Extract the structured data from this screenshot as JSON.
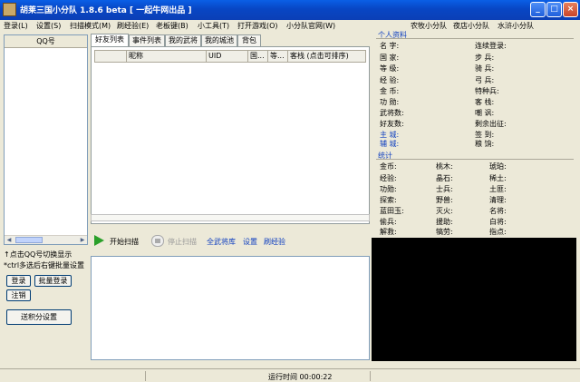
{
  "window": {
    "title": "胡莱三国小分队 1.8.6 beta [ 一起牛网出品 ]"
  },
  "menu": [
    "登录(L)",
    "设置(S)",
    "扫描模式(M)",
    "刷经验(E)",
    "老板键(B)",
    "小工具(T)",
    "打开游戏(O)",
    "小分队官网(W)"
  ],
  "menu_right": [
    "农牧小分队",
    "夜店小分队",
    "水浒小分队"
  ],
  "left_panel": {
    "list_header": "QQ号",
    "tip1": "↑点击QQ号切换显示",
    "tip2": "*ctrl多选后右键批量设置",
    "btn_login": "登录",
    "btn_batch_login": "批量登录",
    "btn_logout": "注销",
    "btn_send_points": "送积分设置"
  },
  "tabs": [
    "好友列表",
    "事件列表",
    "我的武将",
    "我的城池",
    "背包"
  ],
  "grid_columns": [
    "",
    "昵称",
    "UID",
    "国...",
    "等...",
    "客栈 (点击可排序)"
  ],
  "actions": {
    "start": "开始扫描",
    "stop": "停止扫描",
    "all_generals": "全武将库",
    "settings": "设置",
    "refresh_exp": "刷经验"
  },
  "personal_info": {
    "title": "个人资料",
    "rows": [
      {
        "label": "名  字:",
        "value": ""
      },
      {
        "label": "国  家:",
        "value": ""
      },
      {
        "label": "等  级:",
        "value": ""
      },
      {
        "label": "经  验:",
        "value": ""
      },
      {
        "label": "金  币:",
        "value": ""
      },
      {
        "label": "功  勋:",
        "value": ""
      },
      {
        "label": "武将数:",
        "value": ""
      },
      {
        "label": "好友数:",
        "value": ""
      },
      {
        "label": "主  城:",
        "value": ""
      },
      {
        "label": "辅  城:",
        "value": ""
      }
    ],
    "rows_right": [
      {
        "label": "连续登录:",
        "value": ""
      },
      {
        "label": "步  兵:",
        "value": ""
      },
      {
        "label": "骑  兵:",
        "value": ""
      },
      {
        "label": "弓  兵:",
        "value": ""
      },
      {
        "label": "特种兵:",
        "value": ""
      },
      {
        "label": "客  栈:",
        "value": ""
      },
      {
        "label": "嘲  讽:",
        "value": ""
      },
      {
        "label": "剩余出征:",
        "value": ""
      },
      {
        "label": "签  到:",
        "value": ""
      },
      {
        "label": "粮  饷:",
        "value": ""
      }
    ]
  },
  "stats": {
    "title": "统计",
    "col1": [
      "金币:",
      "经验:",
      "功勋:",
      "探索:",
      "蓝田玉:",
      "偷兵:",
      "解救:"
    ],
    "col2": [
      "桃木:",
      "晶石:",
      "士兵:",
      "野兽:",
      "灭火:",
      "援助:",
      "犒劳:"
    ],
    "col3": [
      "琥珀:",
      "稀土:",
      "土匪:",
      "清理:",
      "名将:",
      "白将:",
      "指点:"
    ]
  },
  "statusbar": {
    "runtime_label": "运行时间",
    "runtime_value": "00:00:22"
  }
}
